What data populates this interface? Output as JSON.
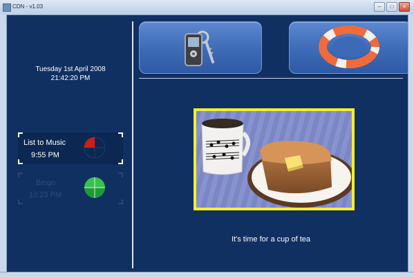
{
  "window": {
    "title": "CDN - v1.03",
    "min": "–",
    "max": "□",
    "close": "×"
  },
  "sidebar": {
    "date": "Tuesday 1st April 2008",
    "time": "21:42:20 PM",
    "reminders": [
      {
        "title": "List to Music",
        "time": "9:55 PM",
        "state": "active",
        "clock_fraction_elapsed": 0.25
      },
      {
        "title": "Bingo",
        "time": "10:23 PM",
        "state": "upcoming",
        "clock_fraction_elapsed": 0.5
      }
    ]
  },
  "tiles": [
    {
      "icon": "phone-keys-icon"
    },
    {
      "icon": "lifebuoy-icon"
    }
  ],
  "message": {
    "caption": "It's time for a cup of tea",
    "image": "tea-and-toast-photo"
  },
  "colors": {
    "background": "#113062",
    "tile": "#4a78c2",
    "frame": "#f6ef2a",
    "alert_red": "#d21c18",
    "clock_green": "#22a43a"
  }
}
